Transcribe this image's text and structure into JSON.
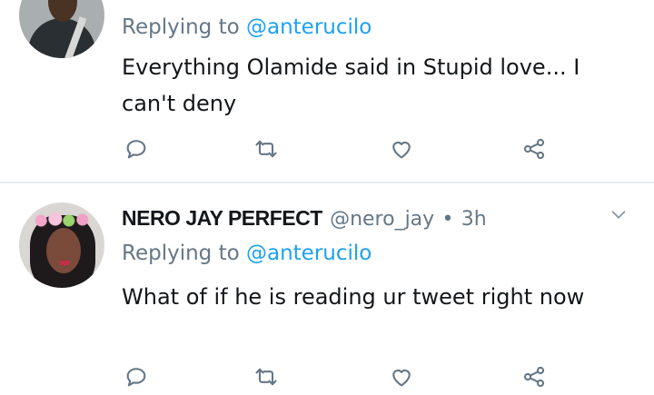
{
  "tweets": [
    {
      "replying_prefix": "Replying to ",
      "replying_to": "@anterucilo",
      "text": "Everything Olamide said in Stupid love... I can't deny"
    },
    {
      "name": "NERO JAY PERFECT",
      "handle": "@nero_jay",
      "separator": "•",
      "time": "3h",
      "replying_prefix": "Replying to ",
      "replying_to": "@anterucilo",
      "text": "What of if he is reading ur tweet right now"
    }
  ],
  "colors": {
    "accent": "#1da1f2",
    "muted": "#657786",
    "text": "#14171a",
    "divider": "#e6ecf0"
  },
  "icons": [
    "reply-icon",
    "retweet-icon",
    "like-icon",
    "share-icon",
    "chevron-down-icon"
  ]
}
